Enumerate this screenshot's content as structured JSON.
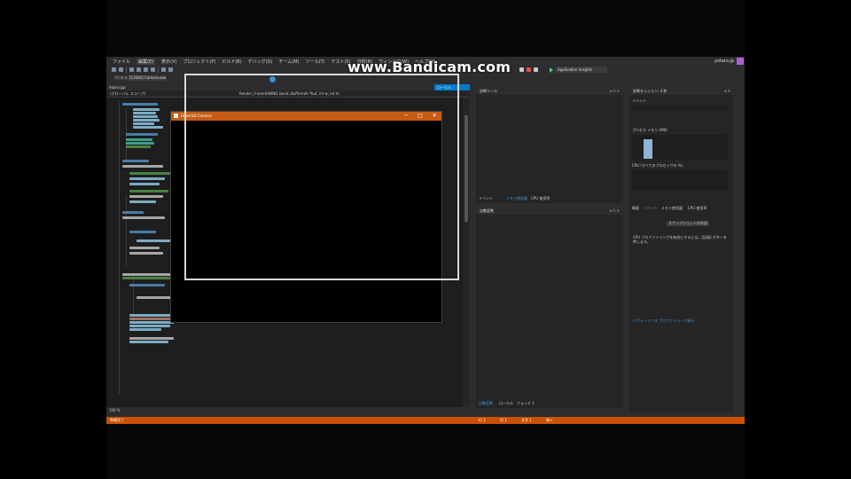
{
  "watermark": "www.Bandicam.com",
  "ide": {
    "menu": [
      "ファイル",
      "編集(E)",
      "表示(V)",
      "プロジェクト(P)",
      "ビルド(B)",
      "デバッグ(D)",
      "チーム(M)",
      "ツール(T)",
      "テスト(S)",
      "分析(N)",
      "ウィンドウ(W)",
      "ヘルプ(H)"
    ],
    "selected_menu_index": 1,
    "profile": "yotaro.jp",
    "debug_target": "ローカル Windows デバッガー",
    "process_label": "Application Insights",
    "config": {
      "label": "プロセス:",
      "value": "[13484] Camera.exe"
    }
  },
  "editor": {
    "tabs": [
      "main.cpp"
    ],
    "active_tab": 0,
    "nav": {
      "scope": "(グローバル スコープ)",
      "member": "Render_Frame(HWND hwnd, BufferInfo *buf, int w, int h)"
    },
    "status": "100 %"
  },
  "app_window": {
    "title": "Direct3D Camera",
    "buttons": [
      "─",
      "□",
      "✕"
    ]
  },
  "diag_panel": {
    "title": "診断ツール",
    "tabs": [
      "イベント",
      "メモリ使用量",
      "CPU 使用率"
    ],
    "active_tab": 1
  },
  "watch_panel": {
    "title": "自動変数",
    "bottom_tabs": [
      "自動変数",
      "ローカル",
      "ウォッチ 1"
    ]
  },
  "summary_panel": {
    "title": "診断セッション: 3 秒",
    "rows": [
      "イベント",
      "プロセス メモリ (MB)",
      "CPU (すべてのプロセッサの %)"
    ],
    "tabs": [
      "概要",
      "イベント",
      "メモリ使用量",
      "CPU 使用率"
    ],
    "snapshot_button": "スナップショットの作成",
    "cpu_hint": "CPU プロファイリングを有効にするには、[記録] ボタンを押します。",
    "perf_link": "パフォーマンス プロファイラーで表示"
  },
  "statusbar": {
    "left": "準備完了",
    "ln": "行 1",
    "col": "列 1",
    "ch": "文字 1",
    "ins": "挿入"
  }
}
